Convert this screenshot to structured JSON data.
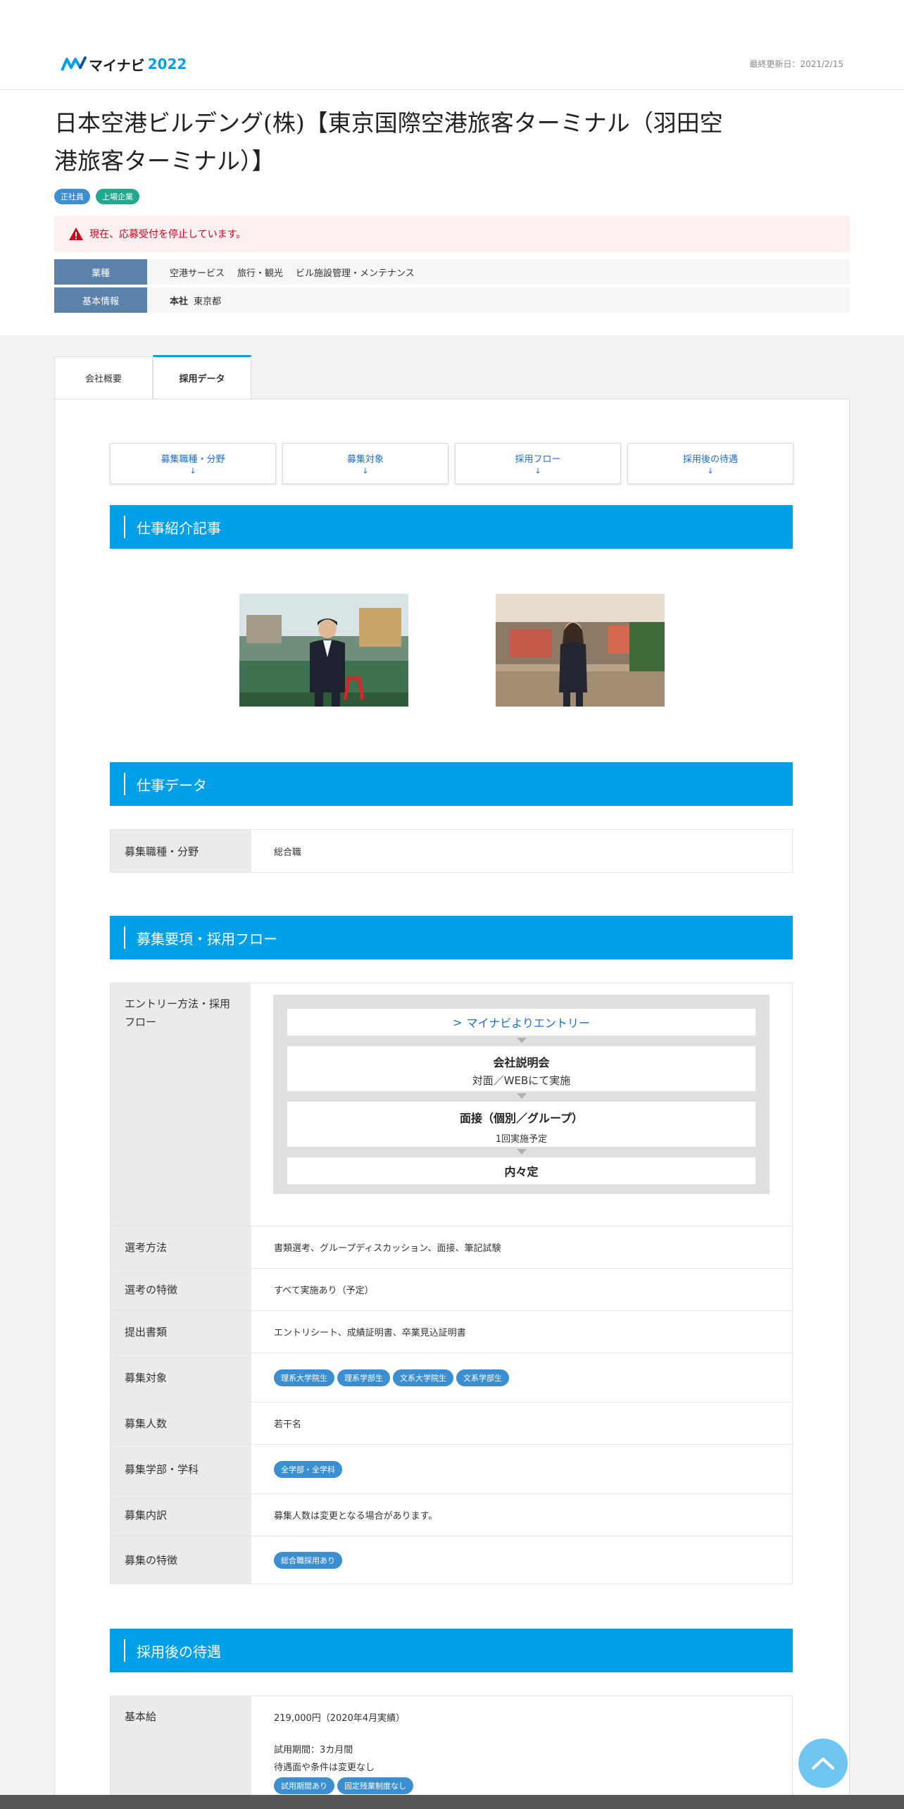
{
  "header": {
    "logo_text": "マイナビ",
    "logo_year": "2022",
    "updated": "最終更新日：2021/2/15"
  },
  "company": {
    "name": "日本空港ビルデング(株)【東京国際空港旅客ターミナル（羽田空港旅客ターミナル）】",
    "tags": [
      "正社員",
      "上場企業"
    ],
    "alert": "現在、応募受付を停止しています。",
    "industry_label": "業種",
    "industries": [
      "空港サービス",
      "旅行・観光",
      "ビル施設管理・メンテナンス"
    ],
    "basic_label": "基本情報",
    "hq_label": "本社",
    "hq_value": "東京都"
  },
  "tabs": [
    "会社概要",
    "採用データ"
  ],
  "anchors": [
    {
      "label": "募集職種・分野",
      "arrow": "↓"
    },
    {
      "label": "募集対象",
      "arrow": "↓"
    },
    {
      "label": "採用フロー",
      "arrow": "↓"
    },
    {
      "label": "採用後の待遇",
      "arrow": "↓"
    }
  ],
  "sections": {
    "articles": "仕事紹介記事",
    "job_data": "仕事データ",
    "recruit": "募集要項・採用フロー",
    "treatment": "採用後の待遇"
  },
  "job_data": {
    "label": "募集職種・分野",
    "value": "総合職"
  },
  "recruit": {
    "entry_label": "エントリー方法・採用フロー",
    "flow": {
      "entry": "マイナビよりエントリー",
      "step1_title": "会社説明会",
      "step1_sub": "対面／WEBにて実施",
      "step2_title": "面接（個別／グループ）",
      "step2_sub": "1回実施予定",
      "step3_title": "内々定"
    },
    "rows": [
      {
        "label": "選考方法",
        "value": "書類選考、グループディスカッション、面接、筆記試験"
      },
      {
        "label": "選考の特徴",
        "value": "すべて実施あり（予定）"
      },
      {
        "label": "提出書類",
        "value": "エントリシート、成績証明書、卒業見込証明書"
      }
    ],
    "target_label": "募集対象",
    "target_tags": [
      "理系大学院生",
      "理系学部生",
      "文系大学院生",
      "文系学部生"
    ],
    "count_label": "募集人数",
    "count_value": "若干名",
    "faculty_label": "募集学部・学科",
    "faculty_tags": [
      "全学部・全学科"
    ],
    "breakdown_label": "募集内訳",
    "breakdown_value": "募集人数は変更となる場合があります。",
    "feature_label": "募集の特徴",
    "feature_tags": [
      "総合職採用あり"
    ]
  },
  "treatment": {
    "salary_label": "基本給",
    "salary_value": "219,000円（2020年4月実績）",
    "trial": "試用期間：3カ月間",
    "trial_note": "待遇面や条件は変更なし",
    "tags": [
      "試用期間あり",
      "固定残業制度なし"
    ]
  },
  "colors": {
    "brand": "#00a0e9",
    "label_bg": "#5a82ad",
    "alert": "#d0021b",
    "pill": "#3b8ed0"
  }
}
